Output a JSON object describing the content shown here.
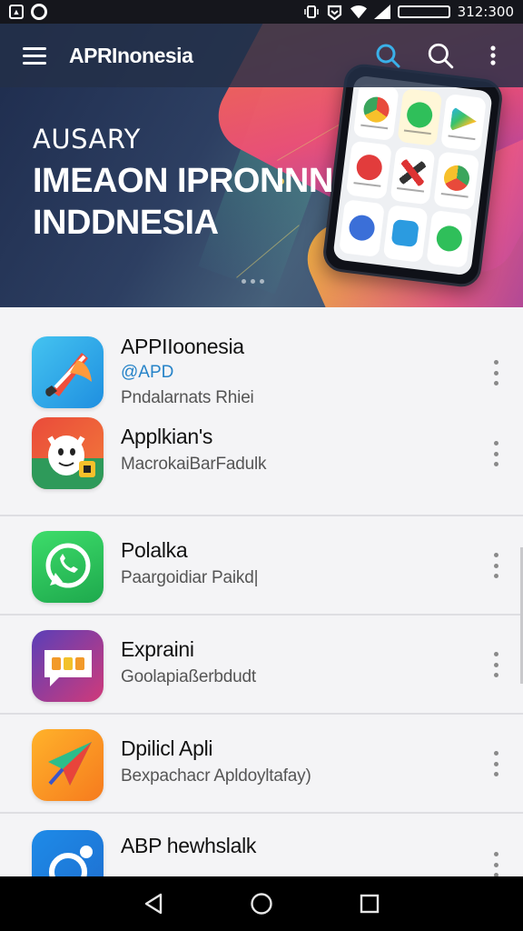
{
  "status_bar": {
    "time": "312:300",
    "left_icons": [
      "gallery-icon",
      "circle-icon"
    ],
    "right_icons": [
      "vibrate-icon",
      "notification-icon",
      "wifi-icon",
      "signal-icon",
      "battery-icon"
    ]
  },
  "toolbar": {
    "title": "APRInonesia",
    "actions": [
      "search-icon",
      "search-icon",
      "more-vert-icon"
    ]
  },
  "banner": {
    "subtitle": "AUSARY",
    "headline_line1": "IMEAON IPRONNN",
    "headline_line2": "INDDNESIA",
    "pages": 3
  },
  "apps": [
    {
      "name": "APPIIoonesia",
      "tag": "@APD",
      "description": "Pndalarnats Rhiei",
      "icon": "paint-brush-icon"
    },
    {
      "name": "Applkian's",
      "tag": "",
      "description": "MacrokaiBarFadulk",
      "icon": "mascot-icon"
    },
    {
      "name": "Polalka",
      "tag": "",
      "description": "Paargoidiar Paikd|",
      "icon": "chat-bubble-icon"
    },
    {
      "name": "Expraini",
      "tag": "",
      "description": "Goolapiaßerbdudt",
      "icon": "message-icon"
    },
    {
      "name": "Dpilicl Apli",
      "tag": "",
      "description": "Bexpachacr Apldoyltafay)",
      "icon": "paper-plane-icon"
    },
    {
      "name": "ABP hewhslalk",
      "tag": "",
      "description": "",
      "icon": "app-icon"
    }
  ],
  "colors": {
    "accent": "#2683c8",
    "toolbar_bg": "#233048",
    "search_highlight": "#3ab0e8"
  },
  "nav": [
    "back-icon",
    "home-icon",
    "recents-icon"
  ]
}
